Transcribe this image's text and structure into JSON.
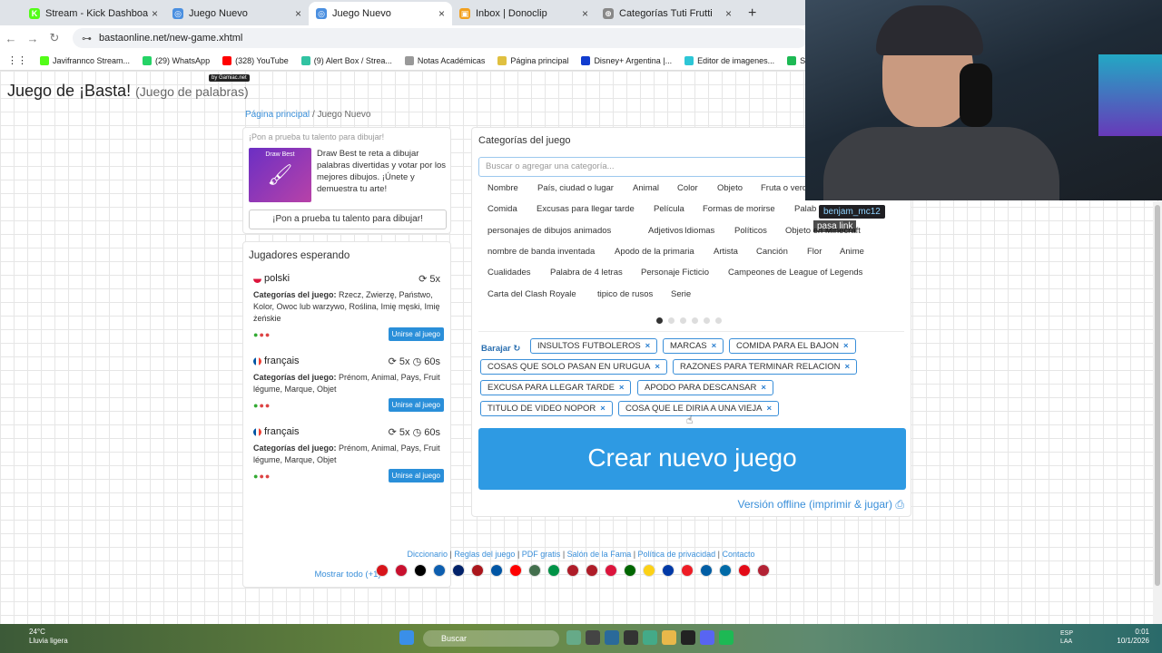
{
  "browser": {
    "tabs": [
      {
        "title": "Stream - Kick Dashboard",
        "color": "#53fc18",
        "glyph": "K"
      },
      {
        "title": "Juego Nuevo",
        "color": "#4a8fe0",
        "glyph": "◎"
      },
      {
        "title": "Juego Nuevo",
        "color": "#4a8fe0",
        "glyph": "◎"
      },
      {
        "title": "Inbox | Donoclip",
        "color": "#f2a01e",
        "glyph": "▣"
      },
      {
        "title": "Categorías Tuti Frutti",
        "color": "#888888",
        "glyph": "⊕"
      }
    ],
    "new_tab": "+",
    "url": "bastaonline.net/new-game.xhtml",
    "bookmarks": [
      {
        "label": "Javifrannco Stream...",
        "color": "#53fc18"
      },
      {
        "label": "(29) WhatsApp",
        "color": "#25d366"
      },
      {
        "label": "(328) YouTube",
        "color": "#ff0000"
      },
      {
        "label": "(9) Alert Box / Strea...",
        "color": "#31c3a2"
      },
      {
        "label": "Notas Académicas",
        "color": "#999999"
      },
      {
        "label": "Página principal",
        "color": "#e0c040"
      },
      {
        "label": "Disney+ Argentina |...",
        "color": "#113ccf"
      },
      {
        "label": "Editor de imagenes...",
        "color": "#2dc6d6"
      },
      {
        "label": "Spotify - Reproduct...",
        "color": "#1db954"
      }
    ]
  },
  "site": {
    "title": "Juego de ¡Basta!",
    "subtitle": "(Juego de palabras)",
    "badge": "by Gamiac.net",
    "breadcrumb_home": "Página principal",
    "breadcrumb_sep": "/",
    "breadcrumb_current": "Juego Nuevo"
  },
  "promo": {
    "header": "¡Pon a prueba tu talento para dibujar!",
    "image_label": "Draw Best",
    "text": "Draw Best te reta a dibujar palabras divertidas y votar por los mejores dibujos. ¡Únete y demuestra tu arte!",
    "button": "¡Pon a prueba tu talento para dibujar!"
  },
  "players": {
    "title": "Jugadores esperando",
    "cats_label": "Categorías del juego:",
    "join_label": "Unirse al juego",
    "show_all": "Mostrar todo (+1)",
    "games": [
      {
        "lang": "polski",
        "rounds": "5x",
        "time": "",
        "cats": "Rzecz, Zwierzę, Państwo, Kolor, Owoc lub warzywo, Roślina, Imię męski, Imię żeńskie"
      },
      {
        "lang": "français",
        "rounds": "5x",
        "time": "60s",
        "cats": "Prénom, Animal, Pays, Fruit légume, Marque, Objet"
      },
      {
        "lang": "français",
        "rounds": "5x",
        "time": "60s",
        "cats": "Prénom, Animal, Pays, Fruit légume, Marque, Objet"
      }
    ]
  },
  "categories": {
    "title": "Categorías del juego",
    "placeholder": "Buscar o agregar una categoría...",
    "rows": [
      [
        "Nombre",
        "País, ciudad o lugar",
        "Animal",
        "Color",
        "Objeto",
        "Fruta o verd"
      ],
      [
        "Comida",
        "Excusas para llegar tarde",
        "Película",
        "Formas de morirse",
        "Palab"
      ],
      [
        "personajes de dibujos animados",
        "Adjetivos",
        "Idiomas",
        "Políticos",
        "Objeto en Minecraft"
      ],
      [
        "nombre de banda inventada",
        "Apodo de la primaria",
        "Artista",
        "Canción",
        "Flor",
        "Anime"
      ],
      [
        "Cualidades",
        "Palabra de 4 letras",
        "Personaje Ficticio",
        "Campeones de League of Legends"
      ],
      [
        "Carta del Clash Royale",
        "tipico de rusos",
        "Serie"
      ]
    ],
    "shuffle": "Barajar",
    "selected": [
      "INSULTOS FUTBOLEROS",
      "MARCAS",
      "COMIDA PARA EL BAJON",
      "COSAS QUE SOLO PASAN EN URUGUA",
      "RAZONES PARA TERMINAR RELACION",
      "EXCUSA PARA LLEGAR TARDE",
      "APODO PARA DESCANSAR",
      "TITULO DE VIDEO NOPOR",
      "COSA QUE LE DIRIA A UNA VIEJA"
    ],
    "remove_glyph": "×",
    "create_button": "Crear nuevo juego",
    "offline_link": "Versión offline (imprimir & jugar)"
  },
  "footer": {
    "links": [
      "Diccionario",
      "Reglas del juego",
      "PDF gratis",
      "Salón de la Fama",
      "Política de privacidad",
      "Contacto"
    ],
    "flag_colors": [
      "#d7141a",
      "#c8102e",
      "#000000",
      "#0d5eaf",
      "#012169",
      "#aa151b",
      "#0055a4",
      "#ff0000",
      "#436f4d",
      "#009246",
      "#ae1c28",
      "#ae1c28",
      "#dc143c",
      "#006600",
      "#fcd116",
      "#0039a6",
      "#ee1c25",
      "#005da4",
      "#006aa7",
      "#e30a17",
      "#b22234"
    ]
  },
  "stream": {
    "chat_user": "benjam_mc12",
    "chat_message": "pasa link"
  },
  "taskbar": {
    "weather_temp": "24°C",
    "weather_desc": "Lluvia ligera",
    "search": "Buscar",
    "lang1": "ESP",
    "lang2": "LAA",
    "time": "0:01",
    "date": "10/1/2026"
  }
}
